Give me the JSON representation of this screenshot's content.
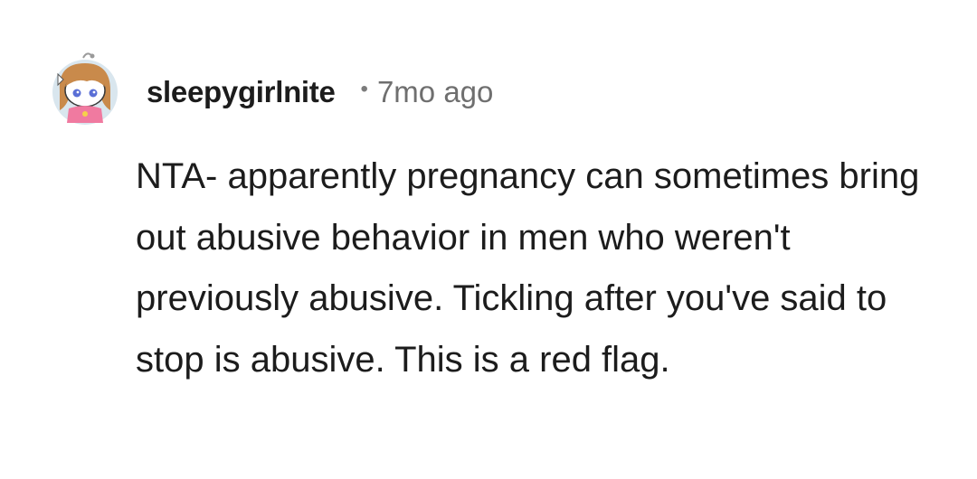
{
  "comment": {
    "username": "sleepygirlnite",
    "separator": "•",
    "timestamp": "7mo ago",
    "avatar_icon": "anime-girl-avatar-icon",
    "body": "NTA- apparently pregnancy can sometimes bring out abusive behavior in men who weren't previously abusive. Tickling after you've said to stop is abusive. This is a red flag."
  },
  "colors": {
    "text": "#1c1c1c",
    "meta": "#6f6f6f",
    "avatar_bg": "#d9e6ee",
    "hair": "#c98a4b",
    "shirt": "#f07aa0"
  }
}
